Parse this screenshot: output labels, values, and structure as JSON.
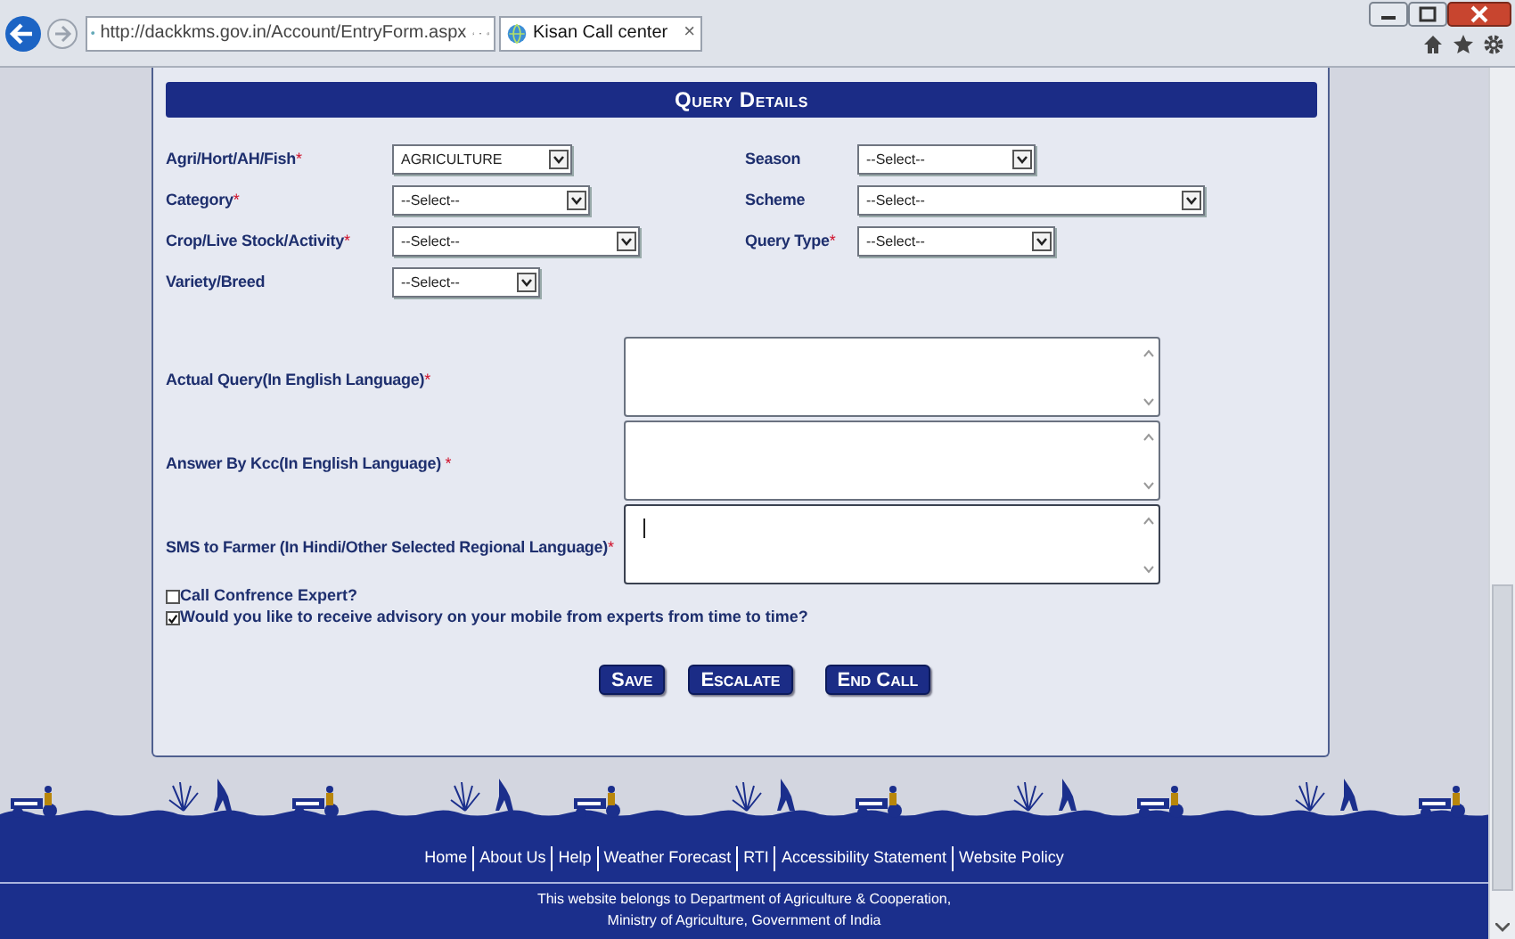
{
  "browser": {
    "address": "http://dackkms.gov.in/Account/EntryForm.aspx",
    "tab_title": "Kisan Call center",
    "tab_close": "×"
  },
  "form": {
    "title": "Query Details",
    "fields": [
      {
        "label": "Agri/Hort/AH/Fish",
        "required_mark": "*",
        "value": "AGRICULTURE"
      },
      {
        "label": "Season",
        "value": "--Select--"
      },
      {
        "label": "Category",
        "required_mark": "*",
        "value": "--Select--"
      },
      {
        "label": "Scheme",
        "value": "--Select--"
      },
      {
        "label": "Crop/Live Stock/Activity",
        "required_mark": "*",
        "value": "--Select--"
      },
      {
        "label": "Query Type",
        "required_mark": "*",
        "value": "--Select--"
      },
      {
        "label": "Variety/Breed",
        "value": "--Select--"
      }
    ],
    "text_areas": [
      {
        "label": "Actual Query(In English Language)",
        "required_mark": "*",
        "focused": false
      },
      {
        "label": "Answer By Kcc(In English Language) ",
        "required_mark": "*",
        "focused": false
      },
      {
        "label": "SMS to Farmer (In Hindi/Other Selected Regional Language)",
        "required_mark": "*",
        "focused": true
      }
    ],
    "checkboxes": [
      {
        "label": "Call Confrence Expert?",
        "checked": false
      },
      {
        "label": "Would you like to receive advisory on your mobile from experts from time to time?",
        "checked": true
      }
    ],
    "buttons": [
      "Save",
      "Escalate",
      "End Call"
    ]
  },
  "footer": {
    "links": [
      "Home",
      "About Us",
      "Help",
      "Weather Forecast",
      "RTI",
      "Accessibility Statement",
      "Website Policy"
    ],
    "notice": [
      "This website belongs to Department of Agriculture & Cooperation,",
      "Ministry of Agriculture, Government of India"
    ]
  }
}
